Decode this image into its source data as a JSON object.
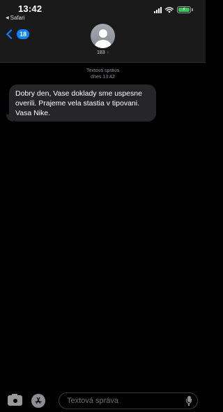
{
  "status_bar": {
    "time": "13:42",
    "back_app_label": "Safari",
    "icons": [
      "cellular-signal-icon",
      "wifi-icon",
      "battery-charging-icon"
    ]
  },
  "nav": {
    "back_badge": "18",
    "contact_name": "183",
    "contact_caret": "›"
  },
  "conversation": {
    "timestamp_label": "Textová správa",
    "timestamp_time": "dnes 13:42",
    "messages": [
      {
        "direction": "incoming",
        "text": "Dobry den, Vase doklady sme uspesne overili. Prajeme vela stastia v tipovani. Vasa Nike."
      }
    ]
  },
  "composer": {
    "placeholder": "Textová správa",
    "icons": [
      "camera-icon",
      "app-store-icon",
      "microphone-icon"
    ]
  },
  "colors": {
    "accent": "#0a84ff",
    "battery": "#35c759",
    "bubble_incoming": "#262628",
    "background": "#000000"
  }
}
